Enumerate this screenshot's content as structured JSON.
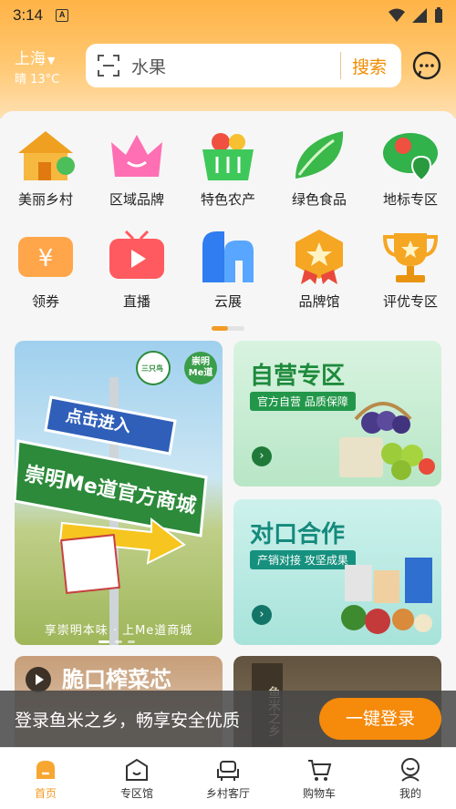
{
  "status_bar": {
    "time": "3:14",
    "notification_glyph": "A"
  },
  "header": {
    "city": "上海",
    "weather": "晴 13°C",
    "search": {
      "value": "水果",
      "button": "搜索"
    }
  },
  "categories": [
    {
      "label": "美丽乡村",
      "icon": "village-icon"
    },
    {
      "label": "区域品牌",
      "icon": "crown-icon"
    },
    {
      "label": "特色农产",
      "icon": "basket-icon"
    },
    {
      "label": "绿色食品",
      "icon": "leaf-icon"
    },
    {
      "label": "地标专区",
      "icon": "location-pin-icon"
    },
    {
      "label": "领券",
      "icon": "coupon-icon"
    },
    {
      "label": "直播",
      "icon": "live-tv-icon"
    },
    {
      "label": "云展",
      "icon": "cloud-exhibition-icon"
    },
    {
      "label": "品牌馆",
      "icon": "brand-badge-icon"
    },
    {
      "label": "评优专区",
      "icon": "trophy-icon"
    }
  ],
  "banners": {
    "main": {
      "sign_top": "点击进入",
      "sign_main": "崇明Me道官方商城",
      "caption": "享崇明本味 · 上Me道商城",
      "logo_text": "崇明 Me道",
      "logo_badge": "三只鸟"
    },
    "self_operated": {
      "title": "自营专区",
      "tag": "官方自营 品质保障"
    },
    "partnership": {
      "title": "对口合作",
      "tag": "产销对接 攻坚成果"
    },
    "video": {
      "title": "脆口榨菜芯"
    },
    "stone": {
      "text": "鱼米之乡"
    }
  },
  "login_bar": {
    "text": "登录鱼米之乡，畅享安全优质",
    "button": "一键登录"
  },
  "tabs": [
    {
      "label": "首页",
      "icon": "home-icon",
      "active": true
    },
    {
      "label": "专区馆",
      "icon": "pavilion-icon",
      "active": false
    },
    {
      "label": "乡村客厅",
      "icon": "sofa-icon",
      "active": false
    },
    {
      "label": "购物车",
      "icon": "cart-icon",
      "active": false
    },
    {
      "label": "我的",
      "icon": "profile-icon",
      "active": false
    }
  ],
  "colors": {
    "accent": "#f58a0b",
    "green": "#1e8a3c",
    "teal": "#148a7c"
  }
}
